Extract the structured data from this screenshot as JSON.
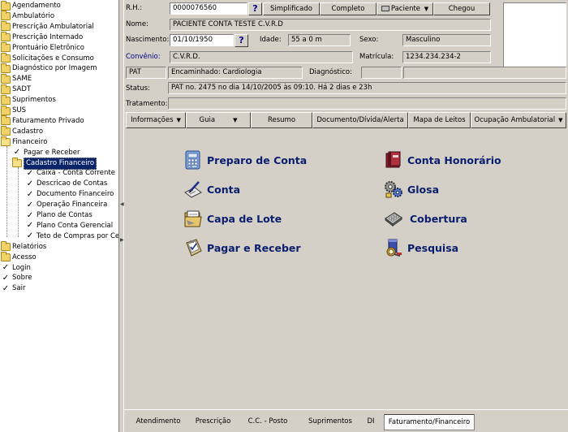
{
  "tree": {
    "items": [
      {
        "label": "Agendamento",
        "icon": "folder-icon"
      },
      {
        "label": "Ambulatório",
        "icon": "folder-icon"
      },
      {
        "label": "Prescrição Ambulatorial",
        "icon": "folder-icon"
      },
      {
        "label": "Prescrição Internado",
        "icon": "folder-icon"
      },
      {
        "label": "Prontuário Eletrônico",
        "icon": "folder-icon"
      },
      {
        "label": "Solicitações e Consumo",
        "icon": "folder-icon"
      },
      {
        "label": "Diagnóstico por Imagem",
        "icon": "folder-icon"
      },
      {
        "label": "SAME",
        "icon": "folder-icon"
      },
      {
        "label": "SADT",
        "icon": "folder-icon"
      },
      {
        "label": "Suprimentos",
        "icon": "folder-icon"
      },
      {
        "label": "SUS",
        "icon": "folder-icon"
      },
      {
        "label": "Faturamento Privado",
        "icon": "folder-icon"
      },
      {
        "label": "Cadastro",
        "icon": "folder-icon"
      },
      {
        "label": "Financeiro",
        "icon": "folder-open-icon"
      },
      {
        "label": "Pagar e Receber",
        "icon": "check-icon"
      },
      {
        "label": "Cadastro Financeiro",
        "icon": "folder-open-icon"
      },
      {
        "label": "Caixa - Conta Corrente",
        "icon": "check-icon"
      },
      {
        "label": "Descricao de Contas",
        "icon": "check-icon"
      },
      {
        "label": "Documento Financeiro",
        "icon": "check-icon"
      },
      {
        "label": "Operação Financeira",
        "icon": "check-icon"
      },
      {
        "label": "Plano de Contas",
        "icon": "check-icon"
      },
      {
        "label": "Plano Conta Gerencial",
        "icon": "check-icon"
      },
      {
        "label": "Teto de Compras por Ce",
        "icon": "check-icon"
      },
      {
        "label": "Relatórios",
        "icon": "folder-icon"
      },
      {
        "label": "Acesso",
        "icon": "folder-icon"
      },
      {
        "label": "Login",
        "icon": "check-icon"
      },
      {
        "label": "Sobre",
        "icon": "check-icon"
      },
      {
        "label": "Sair",
        "icon": "check-icon"
      }
    ]
  },
  "patient": {
    "rh_label": "R.H.:",
    "rh_value": "0000076560",
    "help_glyph": "?",
    "btn_simplificado": "Simplificado",
    "btn_completo": "Completo",
    "btn_paciente": "Paciente",
    "btn_chegou": "Chegou",
    "nome_label": "Nome:",
    "nome_value": "PACIENTE CONTA TESTE C.V.R.D",
    "nascimento_label": "Nascimento:",
    "nascimento_value": "01/10/1950",
    "idade_label": "Idade:",
    "idade_value": "55 a 0 m",
    "sexo_label": "Sexo:",
    "sexo_value": "Masculino",
    "convenio_label": "Convênio:",
    "convenio_value": "C.V.R.D.",
    "matricula_label": "Matrícula:",
    "matricula_value": "1234.234.234-2",
    "pat_value": "PAT",
    "encaminhado_value": "Encaminhado: Cardiologia",
    "diagnostico_label": "Diagnóstico:",
    "status_label": "Status:",
    "status_value": "PAT no. 2475 no dia 14/10/2005  às  09:10. Há 2 dias e 23h",
    "tratamento_label": "Tratamento:"
  },
  "toolbar": {
    "informacoes": "Informações",
    "guia": "Guia",
    "resumo": "Resumo",
    "documento": "Documento/Dívida/Alerta",
    "mapa": "Mapa de Leitos",
    "ocupacao": "Ocupação Ambulatorial",
    "arrow": "▼"
  },
  "commands": {
    "preparo": "Preparo de Conta",
    "conta": "Conta",
    "capa": "Capa de Lote",
    "pagar": "Pagar e Receber",
    "honorario": "Conta Honorário",
    "glosa": "Glosa",
    "cobertura": "Cobertura",
    "pesquisa": "Pesquisa"
  },
  "bottom_tabs": {
    "atendimento": "Atendimento",
    "prescricao": "Prescrição",
    "ccposto": "C.C. - Posto",
    "suprimentos": "Suprimentos",
    "di": "DI",
    "faturamento": "Faturamento/Financeiro"
  },
  "colors": {
    "accent": "#0a246a",
    "command_text": "#0a1e6e",
    "panel": "#d4d0c8"
  }
}
